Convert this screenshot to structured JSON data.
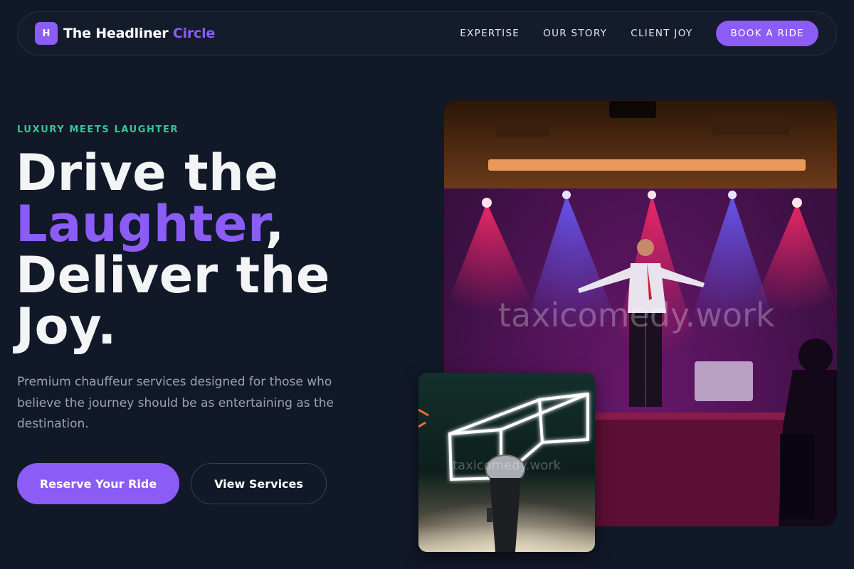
{
  "brand": {
    "badge": "H",
    "name_main": "The Headliner",
    "name_accent": "Circle"
  },
  "nav": {
    "links": [
      "EXPERTISE",
      "OUR STORY",
      "CLIENT JOY"
    ],
    "cta": "BOOK A RIDE"
  },
  "hero": {
    "eyebrow": "LUXURY MEETS LAUGHTER",
    "headline_line1": "Drive the",
    "headline_accent": "Laughter",
    "headline_comma": ",",
    "headline_line3": "Deliver the",
    "headline_line4": "Joy.",
    "subcopy": "Premium chauffeur services designed for those who believe the journey should be as entertaining as the destination.",
    "primary_button": "Reserve Your Ride",
    "secondary_button": "View Services"
  },
  "images": {
    "watermark": "taxicomedy.work"
  },
  "colors": {
    "background": "#111827",
    "accent": "#8b5cf6",
    "eyebrow": "#34c79a"
  }
}
